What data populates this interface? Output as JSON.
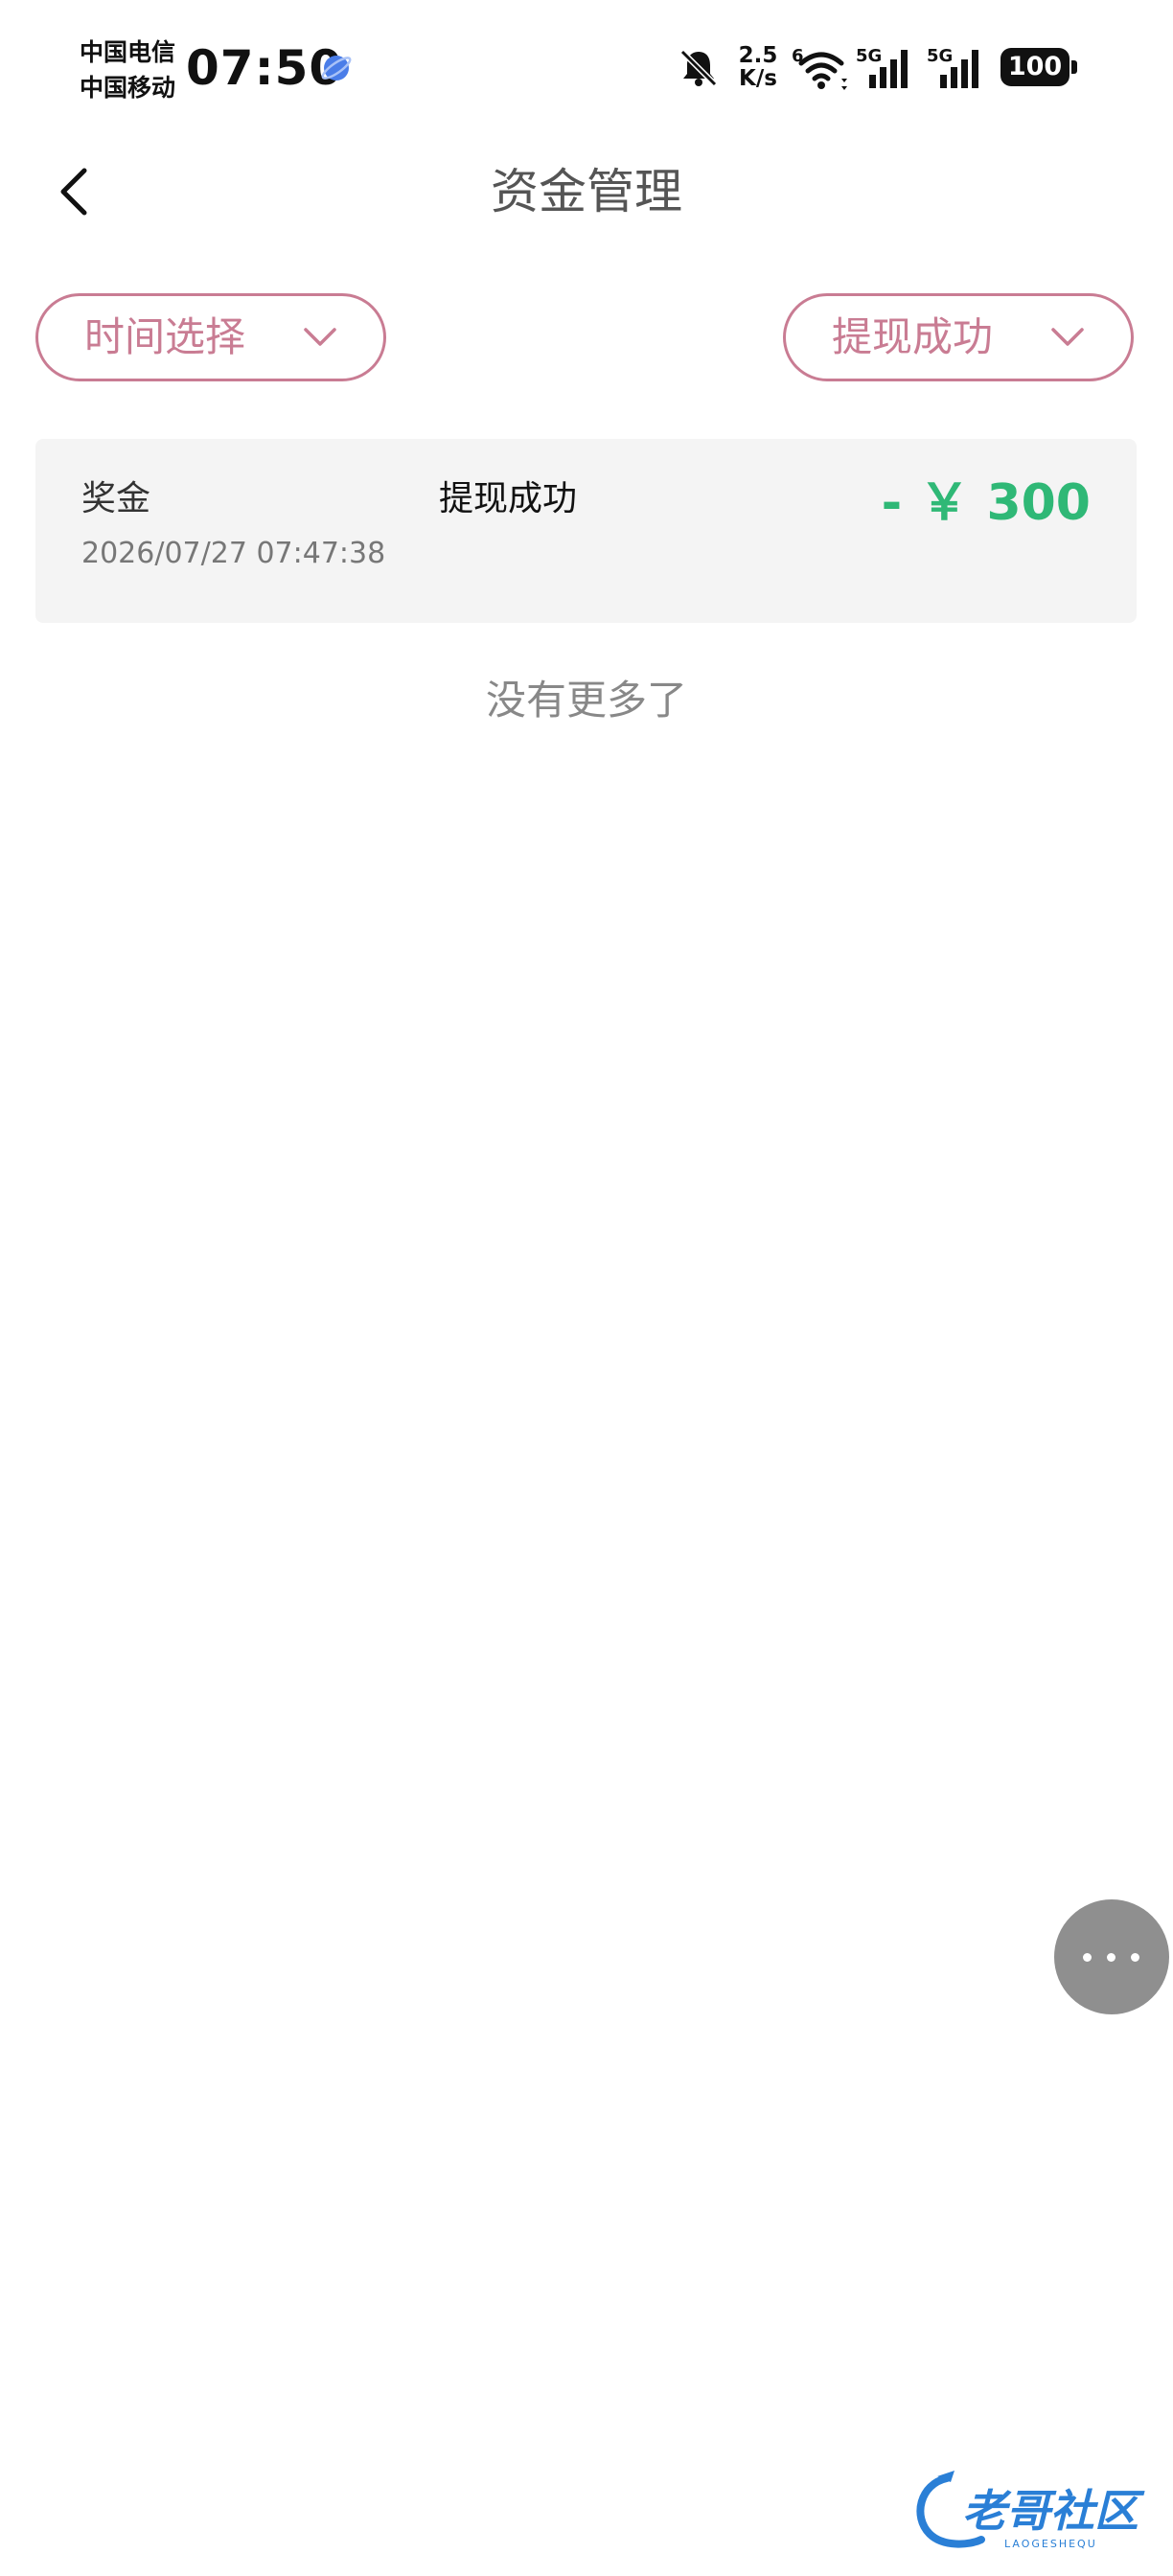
{
  "status_bar": {
    "carrier_1": "中国电信",
    "carrier_2": "中国移动",
    "time": "07:50",
    "net_speed_value": "2.5",
    "net_speed_unit": "K/s",
    "wifi_badge": "6",
    "signal_1_label": "5G",
    "signal_2_label": "5G",
    "battery": "100"
  },
  "header": {
    "title": "资金管理"
  },
  "filters": {
    "time_label": "时间选择",
    "status_label": "提现成功"
  },
  "records": [
    {
      "category": "奖金",
      "status": "提现成功",
      "time": "2026/07/27 07:47:38",
      "amount": "- ￥ 300"
    }
  ],
  "list_footer": "没有更多了",
  "watermark": {
    "text": "老哥社区",
    "subtext": "LAOGESHEQU"
  },
  "colors": {
    "accent_pink": "#c97c93",
    "amount_green": "#2fb876",
    "card_bg": "#f4f4f4"
  }
}
